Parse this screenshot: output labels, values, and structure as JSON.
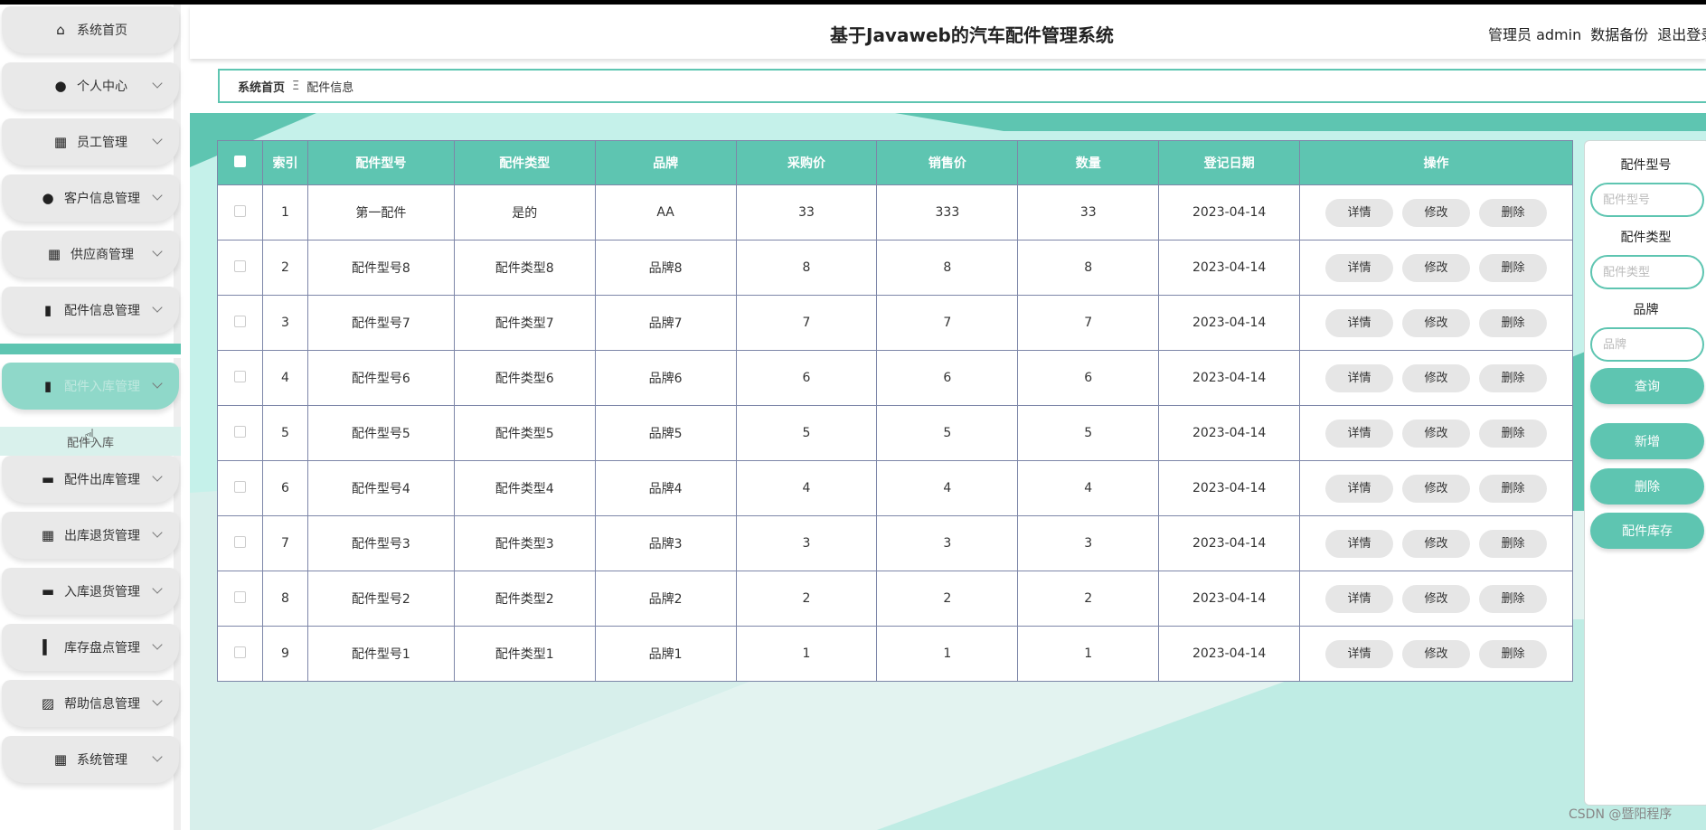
{
  "header": {
    "title": "基于Javaweb的汽车配件管理系统",
    "admin_label": "管理员 admin",
    "backup_label": "数据备份",
    "logout_label": "退出登录"
  },
  "sidebar": {
    "items": [
      {
        "label": "系统首页",
        "icon": "home-icon"
      },
      {
        "label": "个人中心",
        "icon": "person-icon"
      },
      {
        "label": "员工管理",
        "icon": "grid-icon"
      },
      {
        "label": "客户信息管理",
        "icon": "bulb-icon"
      },
      {
        "label": "供应商管理",
        "icon": "grid-icon"
      },
      {
        "label": "配件信息管理",
        "icon": "chart-icon"
      },
      {
        "label": "配件入库管理",
        "icon": "chart-icon"
      },
      {
        "label": "配件出库管理",
        "icon": "briefcase-icon"
      },
      {
        "label": "出库退货管理",
        "icon": "grid-icon"
      },
      {
        "label": "入库退货管理",
        "icon": "printer-icon"
      },
      {
        "label": "库存盘点管理",
        "icon": "bar-chart-icon"
      },
      {
        "label": "帮助信息管理",
        "icon": "line-chart-icon"
      },
      {
        "label": "系统管理",
        "icon": "grid-icon"
      }
    ],
    "sub_item": "配件入库"
  },
  "breadcrumb": {
    "home": "系统首页",
    "sep": "Ξ",
    "current": "配件信息"
  },
  "table": {
    "columns": [
      "索引",
      "配件型号",
      "配件类型",
      "品牌",
      "采购价",
      "销售价",
      "数量",
      "登记日期",
      "操作"
    ],
    "rows": [
      [
        "1",
        "第一配件",
        "是的",
        "AA",
        "33",
        "333",
        "33",
        "2023-04-14"
      ],
      [
        "2",
        "配件型号8",
        "配件类型8",
        "品牌8",
        "8",
        "8",
        "8",
        "2023-04-14"
      ],
      [
        "3",
        "配件型号7",
        "配件类型7",
        "品牌7",
        "7",
        "7",
        "7",
        "2023-04-14"
      ],
      [
        "4",
        "配件型号6",
        "配件类型6",
        "品牌6",
        "6",
        "6",
        "6",
        "2023-04-14"
      ],
      [
        "5",
        "配件型号5",
        "配件类型5",
        "品牌5",
        "5",
        "5",
        "5",
        "2023-04-14"
      ],
      [
        "6",
        "配件型号4",
        "配件类型4",
        "品牌4",
        "4",
        "4",
        "4",
        "2023-04-14"
      ],
      [
        "7",
        "配件型号3",
        "配件类型3",
        "品牌3",
        "3",
        "3",
        "3",
        "2023-04-14"
      ],
      [
        "8",
        "配件型号2",
        "配件类型2",
        "品牌2",
        "2",
        "2",
        "2",
        "2023-04-14"
      ],
      [
        "9",
        "配件型号1",
        "配件类型1",
        "品牌1",
        "1",
        "1",
        "1",
        "2023-04-14"
      ]
    ],
    "actions": {
      "detail": "详情",
      "edit": "修改",
      "delete": "删除"
    }
  },
  "search": {
    "model_label": "配件型号",
    "model_placeholder": "配件型号",
    "type_label": "配件类型",
    "type_placeholder": "配件类型",
    "brand_label": "品牌",
    "brand_placeholder": "品牌",
    "query_button": "查询",
    "add_button": "新增",
    "delete_button": "删除",
    "stock_button": "配件库存"
  },
  "watermark": "CSDN @暨阳程序",
  "colors": {
    "accent": "#5ec5b1",
    "accent_light": "#c3f1e9"
  }
}
